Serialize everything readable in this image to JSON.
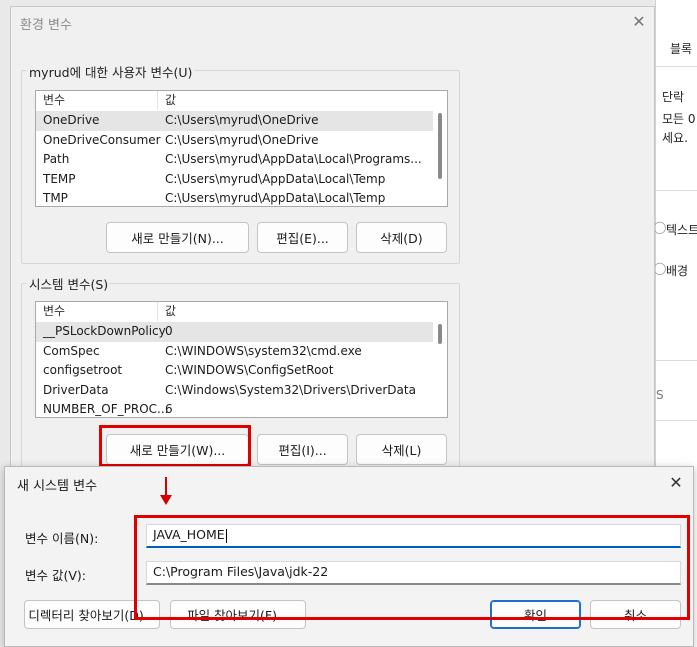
{
  "background_window": {
    "tab_label": "블록",
    "text_lines": [
      "단락",
      "모든 0",
      "세요."
    ],
    "option_1": "텍스트",
    "option_2": "배경",
    "letter_s": "S"
  },
  "env_dialog": {
    "title": "환경 변수",
    "close_glyph": "✕",
    "user_group": {
      "label": "myrud에 대한 사용자 변수(U)",
      "header": {
        "col1": "변수",
        "col2": "값"
      },
      "rows": [
        {
          "name": "OneDrive",
          "value": "C:\\Users\\myrud\\OneDrive"
        },
        {
          "name": "OneDriveConsumer",
          "value": "C:\\Users\\myrud\\OneDrive"
        },
        {
          "name": "Path",
          "value": "C:\\Users\\myrud\\AppData\\Local\\Programs..."
        },
        {
          "name": "TEMP",
          "value": "C:\\Users\\myrud\\AppData\\Local\\Temp"
        },
        {
          "name": "TMP",
          "value": "C:\\Users\\myrud\\AppData\\Local\\Temp"
        }
      ],
      "buttons": {
        "new": "새로 만들기(N)...",
        "edit": "편집(E)...",
        "delete": "삭제(D)"
      }
    },
    "system_group": {
      "label": "시스템 변수(S)",
      "header": {
        "col1": "변수",
        "col2": "값"
      },
      "rows": [
        {
          "name": "__PSLockDownPolicy",
          "value": "0"
        },
        {
          "name": "ComSpec",
          "value": "C:\\WINDOWS\\system32\\cmd.exe"
        },
        {
          "name": "configsetroot",
          "value": "C:\\WINDOWS\\ConfigSetRoot"
        },
        {
          "name": "DriverData",
          "value": "C:\\Windows\\System32\\Drivers\\DriverData"
        },
        {
          "name": "NUMBER_OF_PROC...",
          "value": "6"
        }
      ],
      "buttons": {
        "new": "새로 만들기(W)...",
        "edit": "편집(I)...",
        "delete": "삭제(L)"
      }
    }
  },
  "new_var_dialog": {
    "title": "새 시스템 변수",
    "close_glyph": "✕",
    "name_label": "변수 이름(N):",
    "name_value": "JAVA_HOME",
    "value_label": "변수 값(V):",
    "value_value": "C:\\Program Files\\Java\\jdk-22",
    "buttons": {
      "browse_dir": "디렉터리 찾아보기(D)...",
      "browse_file": "파일 찾아보기(F)...",
      "ok": "확인",
      "cancel": "취소"
    }
  },
  "colors": {
    "highlight_red": "#e00000",
    "accent_blue": "#1d6fce"
  }
}
